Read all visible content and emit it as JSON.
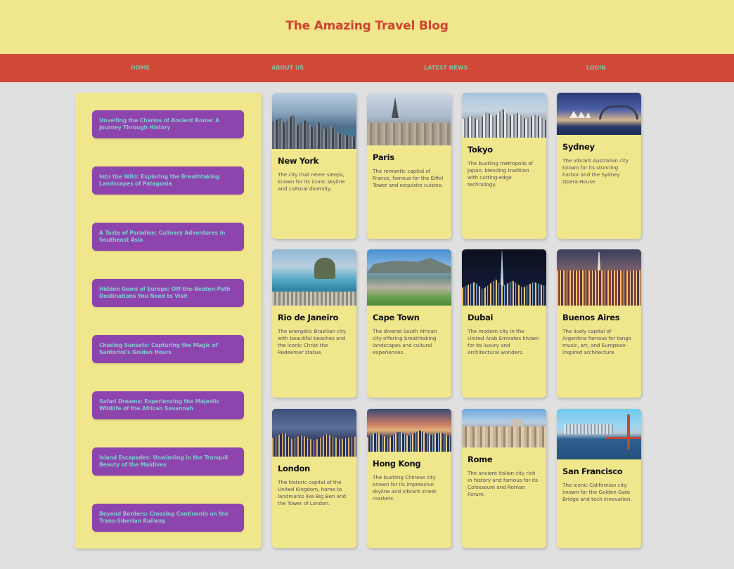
{
  "header": {
    "title": "The Amazing Travel Blog"
  },
  "nav": {
    "items": [
      "HOME",
      "ABOUT US",
      "LATEST NEWS",
      "LOGIN"
    ]
  },
  "sidebar": {
    "items": [
      "Unveiling the Charms of Ancient Rome: A Journey Through History",
      "Into the Wild: Exploring the Breathtaking Landscapes of Patagonia",
      "A Taste of Paradise: Culinary Adventures in Southeast Asia",
      "Hidden Gems of Europe: Off-the-Beaten-Path Destinations You Need to Visit",
      "Chasing Sunsets: Capturing the Magic of Santorini's Golden Hours",
      "Safari Dreams: Experiencing the Majestic Wildlife of the African Savannah",
      "Island Escapades: Unwinding in the Tranquil Beauty of the Maldives",
      "Beyond Borders: Crossing Continents on the Trans-Siberian Railway"
    ]
  },
  "cities": [
    {
      "name": "New York",
      "desc": "The city that never sleeps, known for its iconic skyline and cultural diversity.",
      "image": "new-york-skyline"
    },
    {
      "name": "Paris",
      "desc": "The romantic capital of France, famous for the Eiffel Tower and exquisite cuisine.",
      "image": "paris-eiffel-tower"
    },
    {
      "name": "Tokyo",
      "desc": "The bustling metropolis of Japan, blending tradition with cutting-edge technology.",
      "image": "tokyo-skyline"
    },
    {
      "name": "Sydney",
      "desc": "The vibrant Australian city known for its stunning harbor and the Sydney Opera House.",
      "image": "sydney-harbour"
    },
    {
      "name": "Rio de Janeiro",
      "desc": "The energetic Brazilian city with beautiful beaches and the iconic Christ the Redeemer statue.",
      "image": "rio-bay"
    },
    {
      "name": "Cape Town",
      "desc": "The diverse South African city offering breathtaking landscapes and cultural experiences.",
      "image": "cape-town-table-mountain"
    },
    {
      "name": "Dubai",
      "desc": "The modern city in the United Arab Emirates known for its luxury and architectural wonders.",
      "image": "dubai-night"
    },
    {
      "name": "Buenos Aires",
      "desc": "The lively capital of Argentina famous for tango music, art, and European-inspired architecture.",
      "image": "buenos-aires-avenue"
    },
    {
      "name": "London",
      "desc": "The historic capital of the United Kingdom, home to landmarks like Big Ben and the Tower of London.",
      "image": "london-night"
    },
    {
      "name": "Hong Kong",
      "desc": "The bustling Chinese city known for its impressive skyline and vibrant street markets.",
      "image": "hong-kong-harbour"
    },
    {
      "name": "Rome",
      "desc": "The ancient Italian city rich in history and famous for its Colosseum and Roman Forum.",
      "image": "rome-rooftops"
    },
    {
      "name": "San Francisco",
      "desc": "The iconic Californian city known for the Golden Gate Bridge and tech innovation.",
      "image": "san-francisco-golden-gate"
    }
  ],
  "colors": {
    "header_bg": "#f0e68c",
    "title": "#d0432f",
    "nav_bg": "#d14836",
    "nav_text": "#7fbfa4",
    "sidebar_item_bg": "#8e44ad",
    "sidebar_item_text": "#7fc7cc",
    "page_bg": "#e0e0e0"
  }
}
